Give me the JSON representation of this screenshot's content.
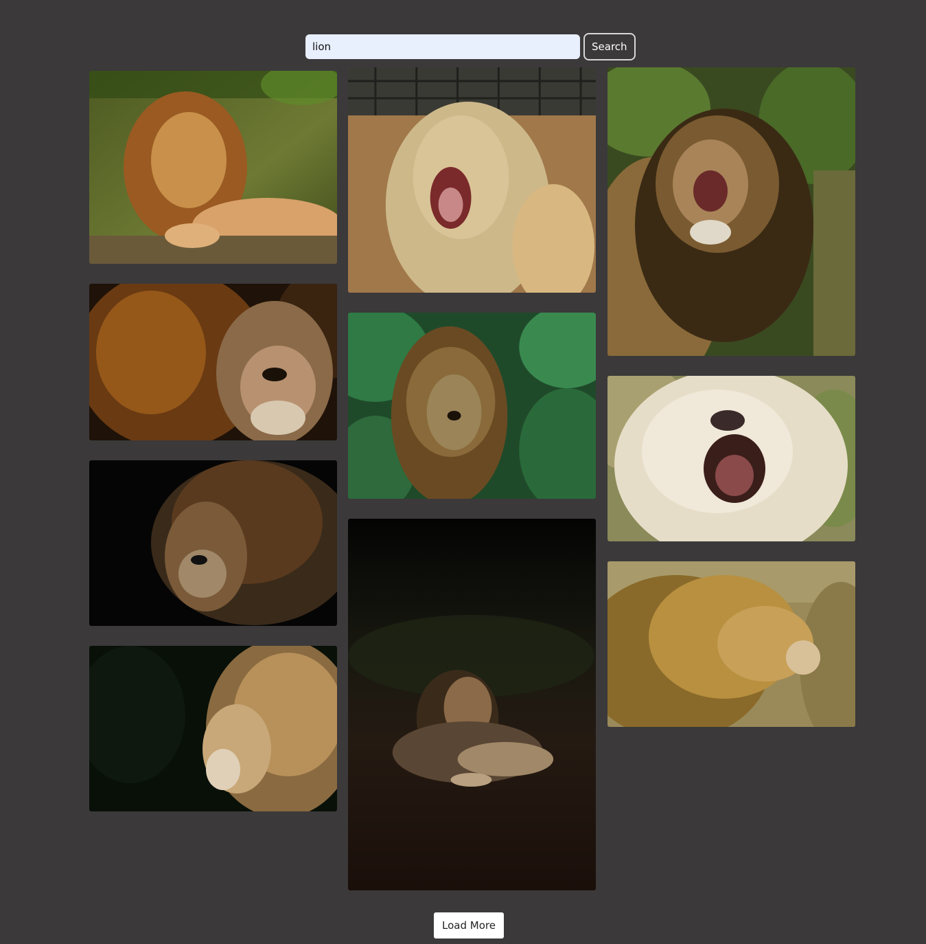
{
  "search": {
    "value": "lion",
    "button_label": "Search"
  },
  "gallery": {
    "photos": [
      {
        "subject": "lion resting on log",
        "column": 1
      },
      {
        "subject": "lion face close-up",
        "column": 1
      },
      {
        "subject": "lion dark background",
        "column": 1
      },
      {
        "subject": "lion profile dark",
        "column": 1
      },
      {
        "subject": "lion yawning in enclosure",
        "column": 2
      },
      {
        "subject": "lion in jungle",
        "column": 2
      },
      {
        "subject": "lion lying at night",
        "column": 2
      },
      {
        "subject": "lion roaring",
        "column": 3
      },
      {
        "subject": "white lion roaring",
        "column": 3
      },
      {
        "subject": "lion in grassland",
        "column": 3
      }
    ]
  },
  "pagination": {
    "load_more_label": "Load More"
  }
}
